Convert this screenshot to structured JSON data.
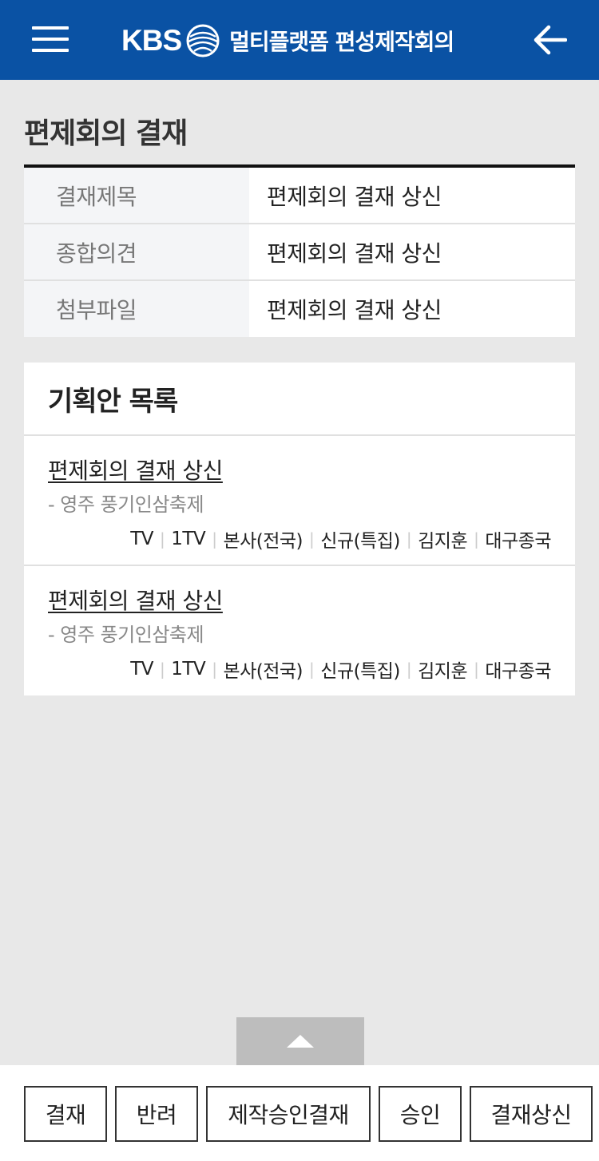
{
  "header": {
    "logo_text": "KBS",
    "title": "멀티플랫폼 편성제작회의"
  },
  "page": {
    "title": "편제회의 결재"
  },
  "info": [
    {
      "label": "결재제목",
      "value": "편제회의 결재 상신"
    },
    {
      "label": "종합의견",
      "value": "편제회의 결재 상신"
    },
    {
      "label": "첨부파일",
      "value": "편제회의 결재 상신"
    }
  ],
  "plan_list": {
    "heading": "기획안 목록",
    "items": [
      {
        "title": "편제회의 결재 상신",
        "subtitle": "- 영주 풍기인삼축제",
        "meta": [
          "TV",
          "1TV",
          "본사(전국)",
          "신규(특집)",
          "김지훈",
          "대구종국"
        ]
      },
      {
        "title": "편제회의 결재 상신",
        "subtitle": "- 영주 풍기인삼축제",
        "meta": [
          "TV",
          "1TV",
          "본사(전국)",
          "신규(특집)",
          "김지훈",
          "대구종국"
        ]
      }
    ]
  },
  "buttons": {
    "approve": "결재",
    "reject": "반려",
    "production_approve": "제작승인결재",
    "accept": "승인",
    "submit": "결재상신"
  },
  "colors": {
    "header_bg": "#0a52a4",
    "page_bg": "#e8e8e8"
  }
}
